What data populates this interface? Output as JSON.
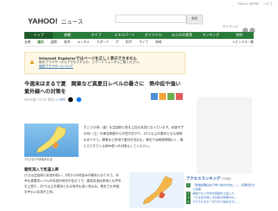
{
  "top_links": [
    "Yahoo! JAPAN",
    "ヘルプ"
  ],
  "search": {
    "button": "検索",
    "placeholder": ""
  },
  "header": {
    "mypage": "マイページ"
  },
  "gnav": [
    "トップ",
    "速報",
    "ライブ",
    "エキスパート",
    "オリジナル",
    "みんなの意見",
    "ランキング",
    "有料"
  ],
  "snav": [
    "主要",
    "国内",
    "国際",
    "経済",
    "エンタメ",
    "スポーツ",
    "IT",
    "科学",
    "ライフ",
    "地域"
  ],
  "snav_right": "トピックス一覧",
  "notice": {
    "title": "Internet Explorerではページを正しく表示できません",
    "message": "他のブラウザーからアクセスするか、スマートフォンからご覧ください。",
    "link": "推奨ブラウザーについて"
  },
  "article": {
    "headline": "今週末はまるで夏　関東など真夏日レベルの暑さに　熱中症や強い紫外線への対策を",
    "date": "4/14(金) 11:22 配信",
    "comment_count": "269",
    "map_caption": "14日(金)予想最高気温",
    "body": "きょう14日（金）も全国的に昇を上回る気温となっています。お昼すぎ19日（土）の東北南部からの空が広がり、25℃以上の夏日となる地域もありそう。関東など各地で夏日を見込む。東北では梅雨時期にく、暖とえてきている熱中症への対策もしてください。",
    "subhead": "暖気流入で気温上昇",
    "para2": "けさは全国的に気温の低い、5月から6月並みの陽気になりそう。日中も真夏日レベルの気温の地点が出そうで、最高気温は各地とも平年を上回り、25℃以上の夏日となる地点も多い見込み。東北でも中国を中心に気温が上昇。"
  },
  "ranking": {
    "title": "アクセスランキング",
    "updated": "(1時間)",
    "items": [
      "「鉄路部署出向子育て前の住宅に…」　近隣住民から苦情",
      "高校でなく中学の同級生と話した…",
      "「行き先不明」の列車が停車中の…",
      "子どもたちの「ゼロから始めます」…"
    ]
  }
}
